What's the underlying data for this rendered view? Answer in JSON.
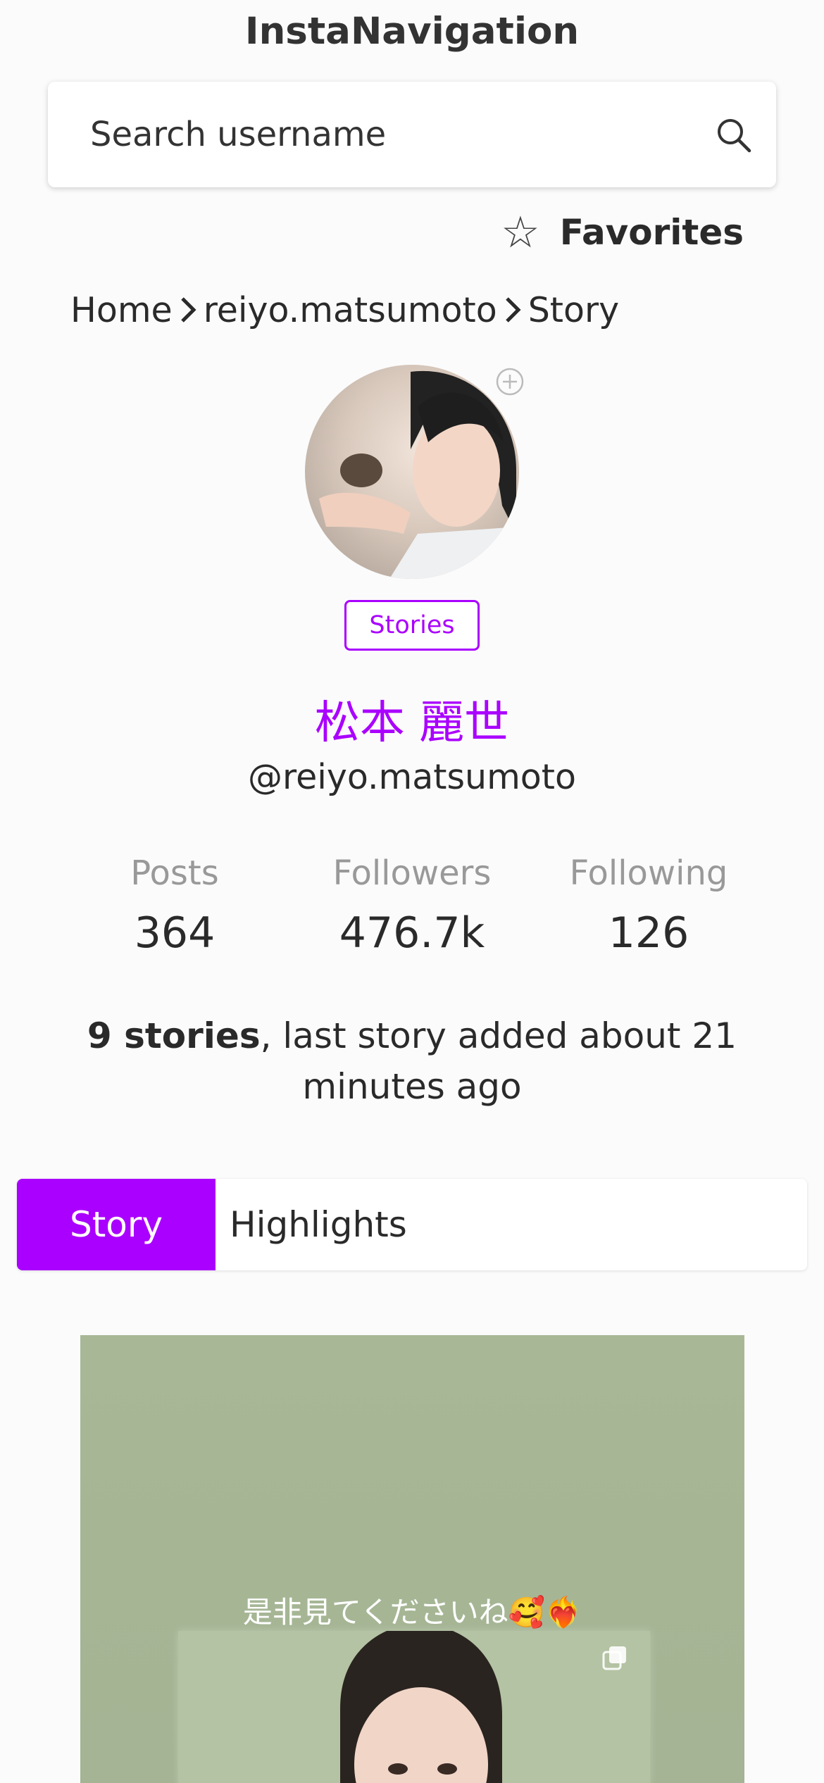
{
  "app": {
    "title": "InstaNavigation"
  },
  "search": {
    "placeholder": "Search username",
    "icon": "search-icon"
  },
  "favorites": {
    "label": "Favorites",
    "icon": "star-outline-icon"
  },
  "breadcrumb": [
    "Home",
    "reiyo.matsumoto",
    "Story"
  ],
  "profile": {
    "badge_label": "Stories",
    "display_name": "松本 麗世",
    "username": "@reiyo.matsumoto",
    "stats": [
      {
        "label": "Posts",
        "value": "364"
      },
      {
        "label": "Followers",
        "value": "476.7k"
      },
      {
        "label": "Following",
        "value": "126"
      }
    ]
  },
  "stories": {
    "count_text": "9 stories",
    "rest_text": ", last story added about 21 minutes ago"
  },
  "tabs": [
    {
      "label": "Story",
      "active": true
    },
    {
      "label": "Highlights",
      "active": false
    }
  ],
  "story_card": {
    "caption": "是非見てくださいね🥰❤️‍🔥"
  },
  "colors": {
    "accent": "#aa00ff",
    "background": "#fbfbfb",
    "story_bg": "#a8b896"
  }
}
